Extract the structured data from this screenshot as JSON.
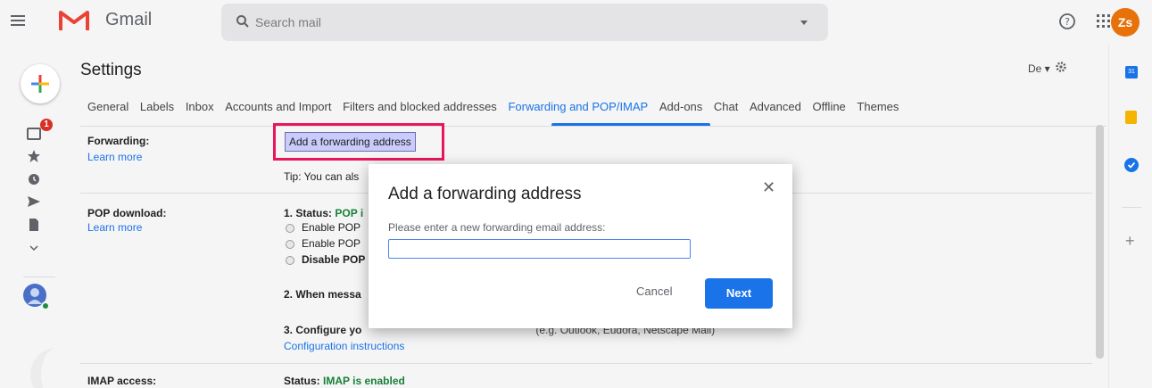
{
  "app": {
    "name": "Gmail",
    "brand_colors": {
      "red": "#ea4335",
      "accent": "#1a73e8"
    }
  },
  "topbar": {
    "menu_icon": "hamburger-menu-icon",
    "search_placeholder": "Search mail",
    "help_icon": "help-icon",
    "apps_icon": "apps-grid-icon",
    "avatar_initials": "Zs"
  },
  "rail": {
    "compose_icon": "compose-plus-icon",
    "inbox_badge": "1",
    "icons": [
      "inbox-icon",
      "star-icon",
      "clock-icon",
      "send-icon",
      "document-icon",
      "chevron-down-icon"
    ]
  },
  "settings": {
    "title": "Settings",
    "density_label": "De",
    "tabs": [
      {
        "label": "General"
      },
      {
        "label": "Labels"
      },
      {
        "label": "Inbox"
      },
      {
        "label": "Accounts and Import"
      },
      {
        "label": "Filters and blocked addresses"
      },
      {
        "label": "Forwarding and POP/IMAP",
        "active": true
      },
      {
        "label": "Add-ons"
      },
      {
        "label": "Chat"
      },
      {
        "label": "Advanced"
      },
      {
        "label": "Offline"
      },
      {
        "label": "Themes"
      }
    ],
    "forwarding": {
      "label": "Forwarding:",
      "learn_more": "Learn more",
      "button": "Add a forwarding address",
      "tip": "Tip: You can als"
    },
    "pop": {
      "label": "POP download:",
      "learn_more": "Learn more",
      "status_prefix": "1. Status: ",
      "status_value": "POP i",
      "options": [
        "Enable POP",
        "Enable POP",
        "Disable POP"
      ],
      "when_message": "2. When messa",
      "configure_prefix": "3. Configure yo",
      "configure_tail": "(e.g. Outlook, Eudora, Netscape Mail)",
      "config_link": "Configuration instructions"
    },
    "imap": {
      "label": "IMAP access:",
      "status_prefix": "Status: ",
      "status_value": "IMAP is enabled"
    }
  },
  "dialog": {
    "title": "Add a forwarding address",
    "prompt": "Please enter a new forwarding email address:",
    "input_value": "",
    "cancel": "Cancel",
    "next": "Next",
    "close_icon": "close-icon"
  }
}
